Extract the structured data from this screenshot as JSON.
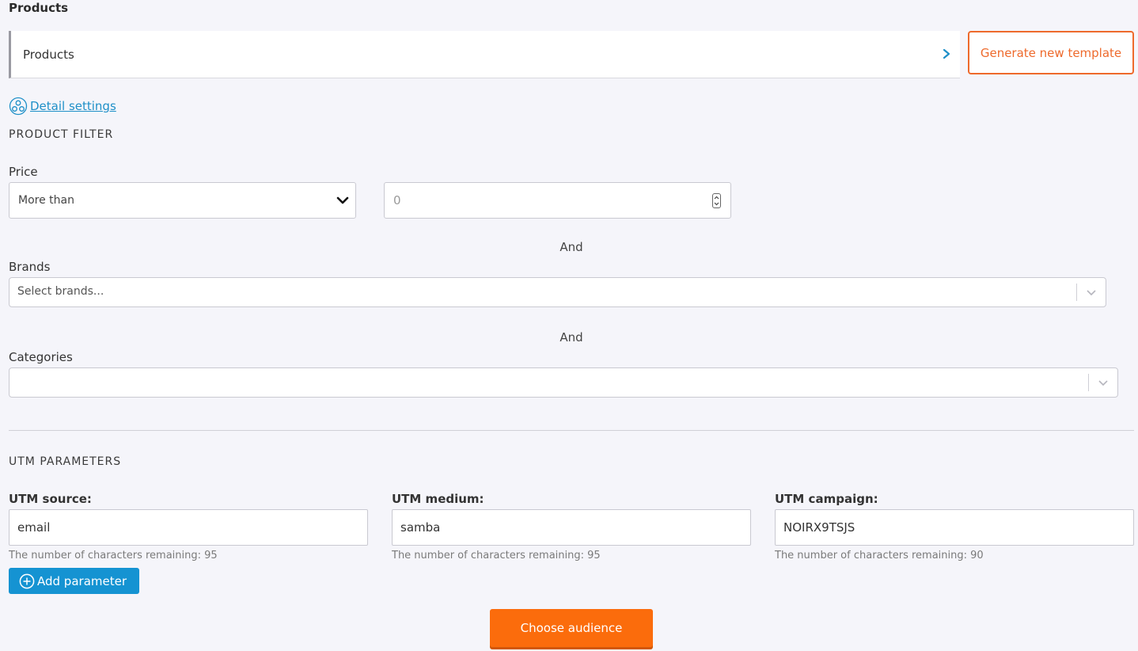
{
  "header": {
    "title": "Products"
  },
  "template": {
    "selected": "Products",
    "generate_label": "Generate new template"
  },
  "detail_settings": {
    "label": "Detail settings"
  },
  "product_filter": {
    "heading": "PRODUCT FILTER",
    "price": {
      "label": "Price",
      "operator": "More than",
      "value_placeholder": "0"
    },
    "and_1": "And",
    "brands": {
      "label": "Brands",
      "placeholder": "Select brands..."
    },
    "and_2": "And",
    "categories": {
      "label": "Categories",
      "placeholder": ""
    }
  },
  "utm": {
    "heading": "UTM PARAMETERS",
    "source": {
      "label": "UTM source:",
      "value": "email",
      "hint": "The number of characters remaining: 95"
    },
    "medium": {
      "label": "UTM medium:",
      "value": "samba",
      "hint": "The number of characters remaining: 95"
    },
    "campaign": {
      "label": "UTM campaign:",
      "value": "NOIRX9TSJS",
      "hint": "The number of characters remaining: 90"
    },
    "add_label": "Add parameter"
  },
  "actions": {
    "choose_audience": "Choose audience"
  },
  "colors": {
    "accent_orange": "#fb6c0c",
    "link_blue": "#1f90c8",
    "button_blue": "#1593d2"
  },
  "icons": {
    "template_chevron": "chevron-right-icon",
    "detail": "settings-circle-icon",
    "price_dropdown": "chevron-down-icon",
    "add": "plus-circle-icon"
  }
}
